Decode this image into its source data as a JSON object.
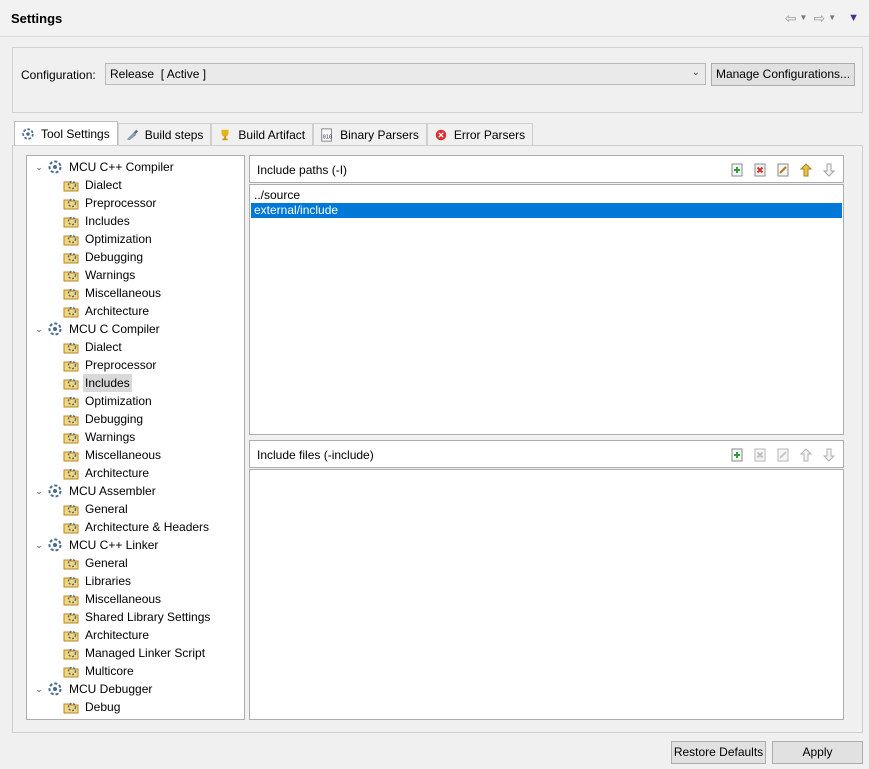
{
  "header": {
    "title": "Settings"
  },
  "config": {
    "label": "Configuration:",
    "value": "Release  [ Active ]",
    "manage_label": "Manage Configurations..."
  },
  "tabs": [
    {
      "label": "Tool Settings",
      "icon": "tool-settings-icon",
      "active": true
    },
    {
      "label": "Build steps",
      "icon": "build-steps-icon"
    },
    {
      "label": "Build Artifact",
      "icon": "trophy-icon"
    },
    {
      "label": "Binary Parsers",
      "icon": "binary-parser-icon"
    },
    {
      "label": "Error Parsers",
      "icon": "error-icon"
    }
  ],
  "tree": [
    {
      "label": "MCU C++ Compiler",
      "level": 0,
      "expanded": true
    },
    {
      "label": "Dialect",
      "level": 1
    },
    {
      "label": "Preprocessor",
      "level": 1
    },
    {
      "label": "Includes",
      "level": 1
    },
    {
      "label": "Optimization",
      "level": 1
    },
    {
      "label": "Debugging",
      "level": 1
    },
    {
      "label": "Warnings",
      "level": 1
    },
    {
      "label": "Miscellaneous",
      "level": 1
    },
    {
      "label": "Architecture",
      "level": 1
    },
    {
      "label": "MCU C Compiler",
      "level": 0,
      "expanded": true
    },
    {
      "label": "Dialect",
      "level": 1
    },
    {
      "label": "Preprocessor",
      "level": 1
    },
    {
      "label": "Includes",
      "level": 1,
      "selected": true
    },
    {
      "label": "Optimization",
      "level": 1
    },
    {
      "label": "Debugging",
      "level": 1
    },
    {
      "label": "Warnings",
      "level": 1
    },
    {
      "label": "Miscellaneous",
      "level": 1
    },
    {
      "label": "Architecture",
      "level": 1
    },
    {
      "label": "MCU Assembler",
      "level": 0,
      "expanded": true
    },
    {
      "label": "General",
      "level": 1
    },
    {
      "label": "Architecture & Headers",
      "level": 1
    },
    {
      "label": "MCU C++ Linker",
      "level": 0,
      "expanded": true
    },
    {
      "label": "General",
      "level": 1
    },
    {
      "label": "Libraries",
      "level": 1
    },
    {
      "label": "Miscellaneous",
      "level": 1
    },
    {
      "label": "Shared Library Settings",
      "level": 1
    },
    {
      "label": "Architecture",
      "level": 1
    },
    {
      "label": "Managed Linker Script",
      "level": 1
    },
    {
      "label": "Multicore",
      "level": 1
    },
    {
      "label": "MCU Debugger",
      "level": 0,
      "expanded": true
    },
    {
      "label": "Debug",
      "level": 1
    }
  ],
  "include_paths": {
    "title": "Include paths (-I)",
    "items": [
      "../source",
      "external/include"
    ],
    "selected_index": 1
  },
  "include_files": {
    "title": "Include files (-include)",
    "items": []
  },
  "footer": {
    "restore_label": "Restore Defaults",
    "apply_label": "Apply"
  },
  "colors": {
    "selection": "#0078d7",
    "error": "#d9302c",
    "trophy": "#e8b21b"
  }
}
